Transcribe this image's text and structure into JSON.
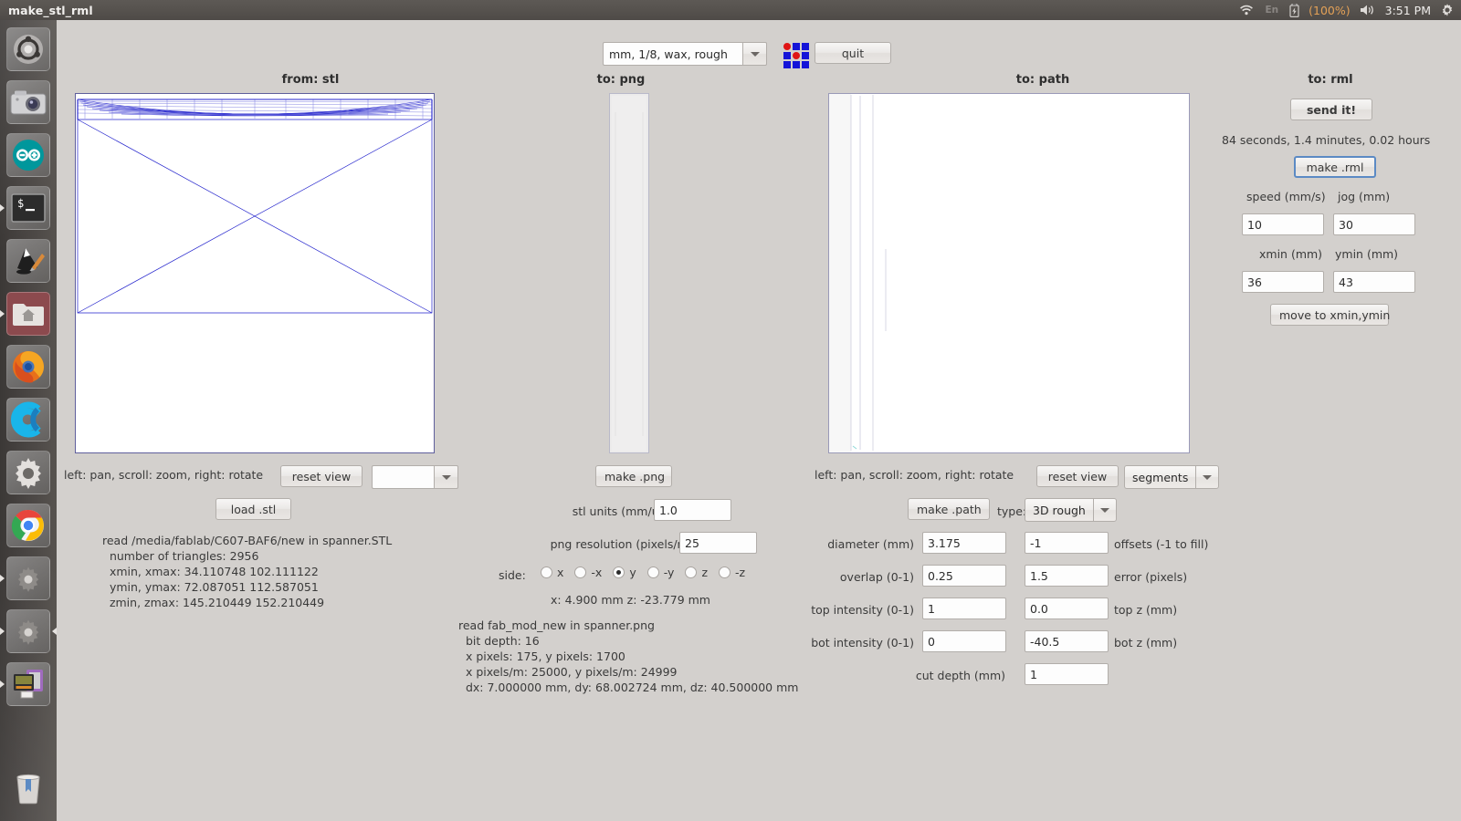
{
  "window": {
    "title": "make_stl_rml"
  },
  "top_panel": {
    "indicators": {
      "wifi": "wifi-icon",
      "keyboard": "En",
      "battery_icon": "battery-icon",
      "battery_percent": "(100%)",
      "volume": "volume-icon",
      "clock": "3:51 PM",
      "system": "gear-icon"
    }
  },
  "launcher": {
    "items": [
      {
        "name": "ubuntu-dash",
        "label": "Ubuntu Dash",
        "running": false
      },
      {
        "name": "shotwell",
        "label": "Shotwell Camera",
        "running": false
      },
      {
        "name": "arduino",
        "label": "Arduino IDE",
        "running": false
      },
      {
        "name": "terminal",
        "label": "Terminal",
        "running": true
      },
      {
        "name": "inkscape",
        "label": "Inkscape",
        "running": false
      },
      {
        "name": "files",
        "label": "Files Home Folder",
        "running": true
      },
      {
        "name": "firefox",
        "label": "Firefox",
        "running": false
      },
      {
        "name": "chromium",
        "label": "Chromium",
        "running": false
      },
      {
        "name": "settings-gear",
        "label": "System Settings",
        "running": false
      },
      {
        "name": "chrome",
        "label": "Google Chrome",
        "running": false
      },
      {
        "name": "app-gear-1",
        "label": "Application",
        "running": true
      },
      {
        "name": "app-gear-2",
        "label": "Application",
        "running": true
      },
      {
        "name": "fab-modules",
        "label": "Fab Modules",
        "running": true
      },
      {
        "name": "trash",
        "label": "Trash",
        "running": false
      }
    ]
  },
  "toolbar": {
    "preset_value": "mm, 1/8, wax, rough",
    "fab_icon": "fab-modules-icon",
    "quit_label": "quit"
  },
  "stl_panel": {
    "title": "from: stl",
    "hint": "left: pan, scroll: zoom, right: rotate",
    "reset_view_label": "reset view",
    "view_select_value": "",
    "load_label": "load .stl",
    "info": [
      "read /media/fablab/C607-BAF6/new in spanner.STL",
      "  number of triangles: 2956",
      "  xmin, xmax: 34.110748 102.111122",
      "  ymin, ymax: 72.087051 112.587051",
      "  zmin, zmax: 145.210449 152.210449"
    ]
  },
  "png_panel": {
    "title": "to: png",
    "make_label": "make .png",
    "stl_units_label": "stl units (mm/unit):",
    "stl_units_value": "1.0",
    "png_res_label": "png resolution (pixels/mm):",
    "png_res_value": "25",
    "side_label": "side:",
    "sides": [
      {
        "label": "x",
        "selected": false
      },
      {
        "label": "-x",
        "selected": false
      },
      {
        "label": "y",
        "selected": true
      },
      {
        "label": "-y",
        "selected": false
      },
      {
        "label": "z",
        "selected": false
      },
      {
        "label": "-z",
        "selected": false
      }
    ],
    "coords": "x: 4.900 mm  z: -23.779 mm",
    "info": [
      "read fab_mod_new in spanner.png",
      "  bit depth: 16",
      "  x pixels: 175, y pixels: 1700",
      "  x pixels/m: 25000, y pixels/m: 24999",
      "  dx: 7.000000 mm, dy: 68.002724 mm, dz: 40.500000 mm"
    ]
  },
  "path_panel": {
    "title": "to: path",
    "hint": "left: pan, scroll: zoom, right: rotate",
    "reset_view_label": "reset view",
    "view_select_value": "segments",
    "make_label": "make .path",
    "type_label": "type:",
    "type_value": "3D rough",
    "fields": [
      {
        "label": "diameter (mm)",
        "value": "3.175",
        "right_value": "-1",
        "right_label": "offsets (-1 to fill)"
      },
      {
        "label": "overlap (0-1)",
        "value": "0.25",
        "right_value": "1.5",
        "right_label": "error (pixels)"
      },
      {
        "label": "top intensity (0-1)",
        "value": "1",
        "right_value": "0.0",
        "right_label": "top z (mm)"
      },
      {
        "label": "bot intensity (0-1)",
        "value": "0",
        "right_value": "-40.5",
        "right_label": "bot z (mm)"
      },
      {
        "label": "cut depth (mm)",
        "value": "1",
        "right_value": "",
        "right_label": ""
      }
    ]
  },
  "rml_panel": {
    "title": "to: rml",
    "send_label": "send it!",
    "estimate": "84 seconds, 1.4 minutes, 0.02 hours",
    "make_label": "make .rml",
    "speed_label": "speed (mm/s)",
    "speed_value": "10",
    "jog_label": "jog (mm)",
    "jog_value": "30",
    "xmin_label": "xmin (mm)",
    "xmin_value": "36",
    "ymin_label": "ymin (mm)",
    "ymin_value": "43",
    "move_label": "move to xmin,ymin"
  },
  "colors": {
    "panel_bg": "#d3d0cd",
    "wire": "#1f1fcc",
    "accent_focus": "#5b8ac4",
    "battery_text": "#e3a157"
  }
}
